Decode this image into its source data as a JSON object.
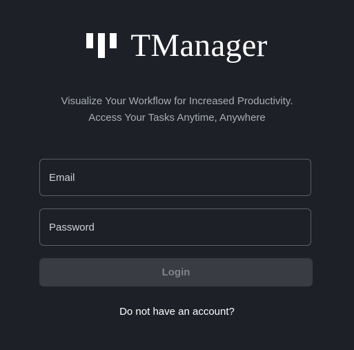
{
  "brand": {
    "name": "TManager",
    "logo_icon": "tmanager-logo-icon"
  },
  "tagline": {
    "line1": "Visualize Your Workflow for Increased Productivity.",
    "line2": "Access Your Tasks Anytime, Anywhere"
  },
  "form": {
    "email_placeholder": "Email",
    "email_value": "",
    "password_placeholder": "Password",
    "password_value": "",
    "login_label": "Login"
  },
  "signup_link": "Do not have an account?",
  "colors": {
    "background": "#1e2028",
    "field_border": "#5a5e67",
    "button_background": "#3a3c43",
    "button_text": "#82858c",
    "tagline_text": "#a9adb6",
    "primary_text": "#ffffff"
  }
}
